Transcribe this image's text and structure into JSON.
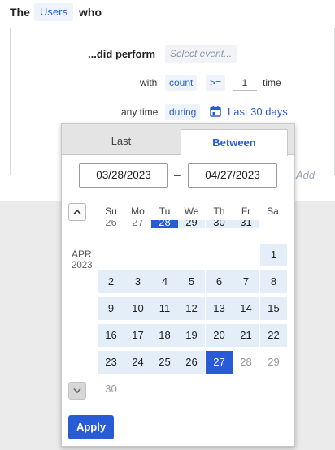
{
  "query": {
    "prefix": "The",
    "entity": "Users",
    "suffix": "who"
  },
  "condition": {
    "did_perform_label": "...did perform",
    "event_placeholder": "Select event...",
    "with_label": "with",
    "count_label": "count",
    "operator": ">=",
    "count_value": "1",
    "time_label": "time",
    "anytime_label": "any time",
    "during_label": "during",
    "range_label": "Last 30 days",
    "add_label": "Add"
  },
  "picker": {
    "tab_last": "Last",
    "tab_between": "Between",
    "start_date": "03/28/2023",
    "end_date": "04/27/2023",
    "separator": "–",
    "weekdays": [
      "Su",
      "Mo",
      "Tu",
      "We",
      "Th",
      "Fr",
      "Sa"
    ],
    "prev_cut_days": [
      "26",
      "27",
      "28",
      "29",
      "30",
      "31"
    ],
    "month_name": "APR",
    "month_year": "2023",
    "days": [
      "1",
      "2",
      "3",
      "4",
      "5",
      "6",
      "7",
      "8",
      "9",
      "10",
      "11",
      "12",
      "13",
      "14",
      "15",
      "16",
      "17",
      "18",
      "19",
      "20",
      "21",
      "22",
      "23",
      "24",
      "25",
      "26",
      "27",
      "28",
      "29",
      "30"
    ],
    "apply_label": "Apply"
  },
  "colors": {
    "accent": "#2a5bd7",
    "range_fill": "#e3eef9"
  }
}
